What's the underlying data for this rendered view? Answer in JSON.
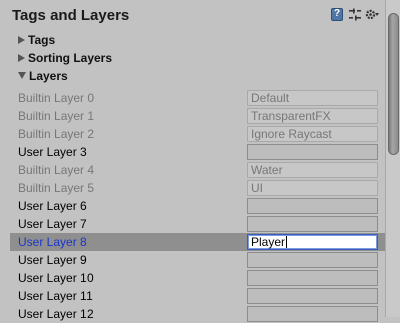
{
  "title": "Tags and Layers",
  "header_icons": [
    "help-icon",
    "preset-icon",
    "gear-icon"
  ],
  "sections": {
    "tags": "Tags",
    "sorting_layers": "Sorting Layers",
    "layers": "Layers"
  },
  "layers": [
    {
      "prefix": "Builtin Layer",
      "index": "0",
      "value": "Default",
      "builtin": true
    },
    {
      "prefix": "Builtin Layer",
      "index": "1",
      "value": "TransparentFX",
      "builtin": true
    },
    {
      "prefix": "Builtin Layer",
      "index": "2",
      "value": "Ignore Raycast",
      "builtin": true
    },
    {
      "prefix": "User Layer",
      "index": "3",
      "value": "",
      "builtin": false
    },
    {
      "prefix": "Builtin Layer",
      "index": "4",
      "value": "Water",
      "builtin": true
    },
    {
      "prefix": "Builtin Layer",
      "index": "5",
      "value": "UI",
      "builtin": true
    },
    {
      "prefix": "User Layer",
      "index": "6",
      "value": "",
      "builtin": false
    },
    {
      "prefix": "User Layer",
      "index": "7",
      "value": "",
      "builtin": false
    },
    {
      "prefix": "User Layer",
      "index": "8",
      "value": "Player",
      "builtin": false,
      "selected": true
    },
    {
      "prefix": "User Layer",
      "index": "9",
      "value": "",
      "builtin": false
    },
    {
      "prefix": "User Layer",
      "index": "10",
      "value": "",
      "builtin": false
    },
    {
      "prefix": "User Layer",
      "index": "11",
      "value": "",
      "builtin": false
    },
    {
      "prefix": "User Layer",
      "index": "12",
      "value": "",
      "builtin": false
    }
  ],
  "colors": {
    "panel_bg": "#c2c2c2",
    "selected_row_bg": "#8f8f8f",
    "selected_label": "#1b35c8"
  }
}
